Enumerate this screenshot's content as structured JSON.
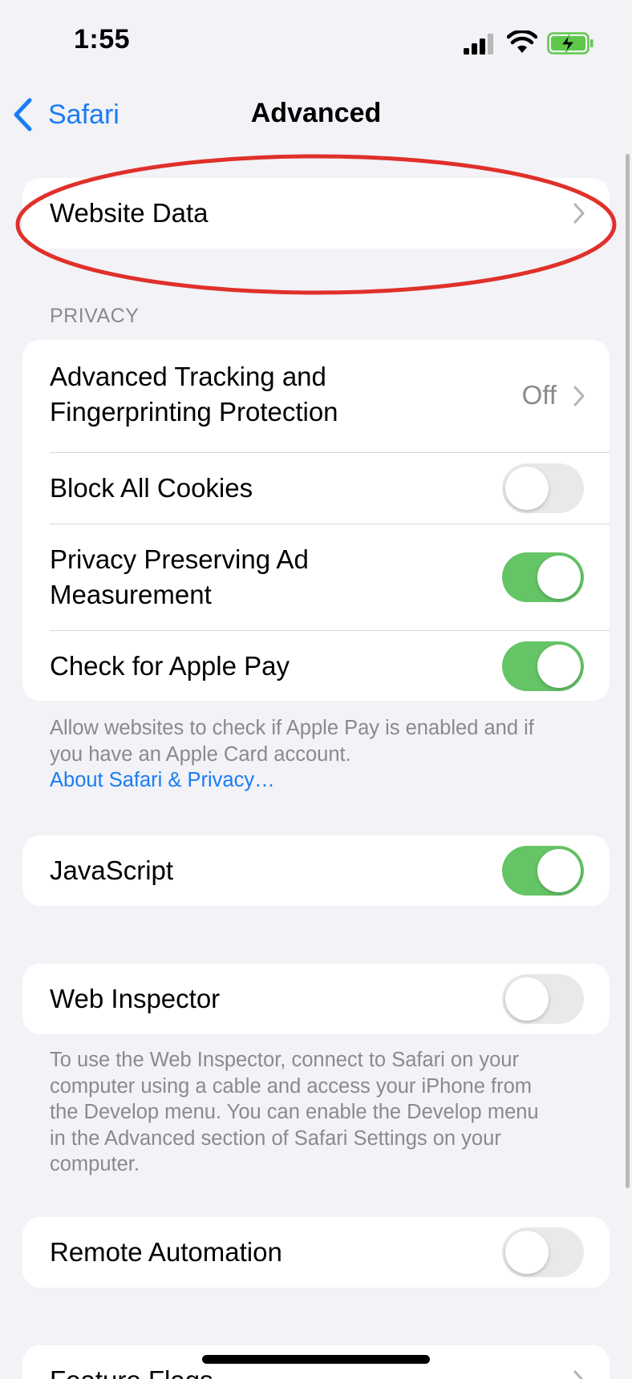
{
  "status_bar": {
    "time": "1:55",
    "battery_color": "#5fc84a"
  },
  "nav": {
    "back_label": "Safari",
    "title": "Advanced"
  },
  "website_data": {
    "label": "Website Data"
  },
  "privacy": {
    "header": "PRIVACY",
    "rows": [
      {
        "label_line1": "Advanced Tracking and",
        "label_line2": "Fingerprinting Protection",
        "value": "Off"
      },
      {
        "label": "Block All Cookies",
        "state": "off"
      },
      {
        "label_line1": "Privacy Preserving Ad",
        "label_line2": "Measurement",
        "state": "on"
      },
      {
        "label": "Check for Apple Pay",
        "state": "on"
      }
    ],
    "footer_line1": "Allow websites to check if Apple Pay is enabled and if",
    "footer_line2": "you have an Apple Card account.",
    "footer_link": "About Safari & Privacy…"
  },
  "javascript": {
    "label": "JavaScript",
    "state": "on"
  },
  "web_inspector": {
    "label": "Web Inspector",
    "state": "off",
    "footer_lines": [
      "To use the Web Inspector, connect to Safari on your",
      "computer using a cable and access your iPhone from",
      "the Develop menu. You can enable the Develop menu",
      "in the Advanced section of Safari Settings on your",
      "computer."
    ]
  },
  "remote_automation": {
    "label": "Remote Automation",
    "state": "off"
  },
  "feature_flags": {
    "label": "Feature Flags"
  },
  "colors": {
    "accent": "#1a7cf5",
    "toggle_on": "#65c466",
    "toggle_off": "#e9e9eb",
    "annotation": "#e0302a",
    "background": "#f2f2f7"
  }
}
